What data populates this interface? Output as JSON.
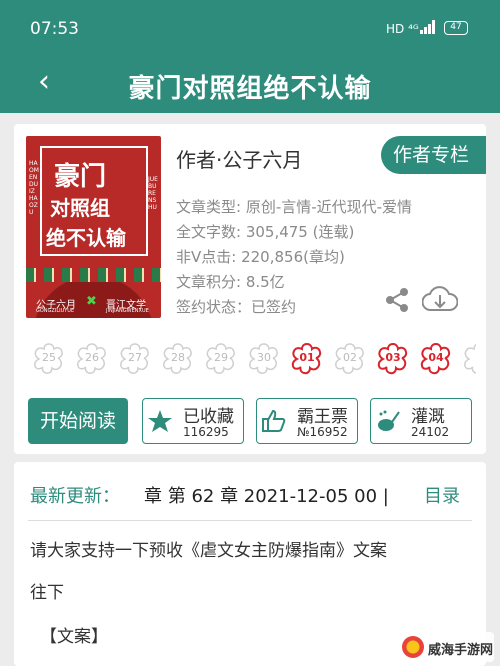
{
  "status_bar": {
    "time": "07:53",
    "network": "HD ⁴ᴳ",
    "battery": "47"
  },
  "header": {
    "back_icon": "back-arrow-icon",
    "title": "豪门对照组绝不认输"
  },
  "book": {
    "cover": {
      "title_line1": "豪门",
      "title_line2": "对照组",
      "title_line3": "绝不认输",
      "side_text_left": "HAOMENDUIZHAOZU",
      "side_text_right": "JUEBURENSHU",
      "author": "公子六月",
      "author_small": "GONGZILIUYUE",
      "cross": "✖",
      "publisher": "晋江文学",
      "publisher_small": "JINJIANGWENXUE"
    },
    "author_line": "作者·公子六月",
    "author_button": "作者专栏",
    "meta": [
      "文章类型: 原创-言情-近代现代-爱情",
      "全文字数: 305,475 (连载)",
      "非Ⅴ点击: 220,856(章均)",
      "文章积分: 8.5亿",
      "签约状态：已签约"
    ]
  },
  "badges": [
    {
      "label": "25",
      "active": false
    },
    {
      "label": "26",
      "active": false
    },
    {
      "label": "27",
      "active": false
    },
    {
      "label": "28",
      "active": false
    },
    {
      "label": "29",
      "active": false
    },
    {
      "label": "30",
      "active": false
    },
    {
      "label": "01",
      "active": true
    },
    {
      "label": "02",
      "active": false
    },
    {
      "label": "03",
      "active": true
    },
    {
      "label": "04",
      "active": true
    }
  ],
  "actions": {
    "read": "开始阅读",
    "favorite": {
      "label": "已收藏",
      "count": "116295",
      "icon": "star-icon"
    },
    "vote": {
      "label": "霸王票",
      "count": "№16952",
      "icon": "thumbs-up-icon"
    },
    "water": {
      "label": "灌溉",
      "count": "24102",
      "icon": "watering-can-icon"
    }
  },
  "latest": {
    "label": "最新更新：",
    "value": "章 第 62 章  2021-12-05 00 |",
    "catalog": "目录"
  },
  "intro": {
    "line1": "请大家支持一下预收《虐文女主防爆指南》文案",
    "line2": "往下",
    "line3": "【文案】"
  },
  "watermark": "威海手游网",
  "colors": {
    "primary": "#2e8c7d",
    "badge_active": "#d9242b",
    "cover_red": "#b72a28"
  }
}
